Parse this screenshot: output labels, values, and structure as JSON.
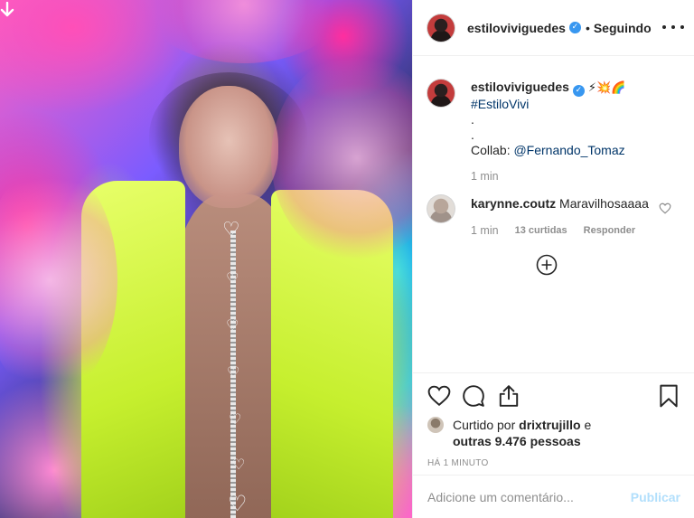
{
  "post": {
    "author": {
      "username": "estiloviviguedes",
      "verified_icon": "verified-badge-icon",
      "separator": "•",
      "follow_status": "Seguindo"
    },
    "caption": {
      "username": "estiloviviguedes",
      "emojis": "⚡💥🌈",
      "hashtag": "#EstiloVivi",
      "line_dot_1": ".",
      "line_dot_2": ".",
      "collab_prefix": "Collab: ",
      "collab_mention": "@Fernando_Tomaz",
      "time": "1 min"
    },
    "comments": [
      {
        "username": "karynne.coutz",
        "text": "Maravilhosaaaa",
        "time": "1 min",
        "likes": "13 curtidas",
        "reply_label": "Responder"
      }
    ],
    "likes": {
      "prefix": "Curtido por ",
      "liker": "drixtrujillo",
      "connector": " e",
      "others": "outras 9.476 pessoas"
    },
    "timestamp": "Há 1 minuto",
    "add_comment": {
      "placeholder": "Adicione um comentário...",
      "post_label": "Publicar"
    },
    "colors": {
      "text": "#262626",
      "secondary": "#8e8e8e",
      "link": "#003569",
      "verified": "#3897f0",
      "post_disabled": "#b2dffc",
      "border": "#efefef"
    },
    "icons": [
      "download-icon",
      "more-options-icon",
      "heart-icon",
      "comment-icon",
      "share-icon",
      "bookmark-icon",
      "load-more-icon"
    ]
  }
}
